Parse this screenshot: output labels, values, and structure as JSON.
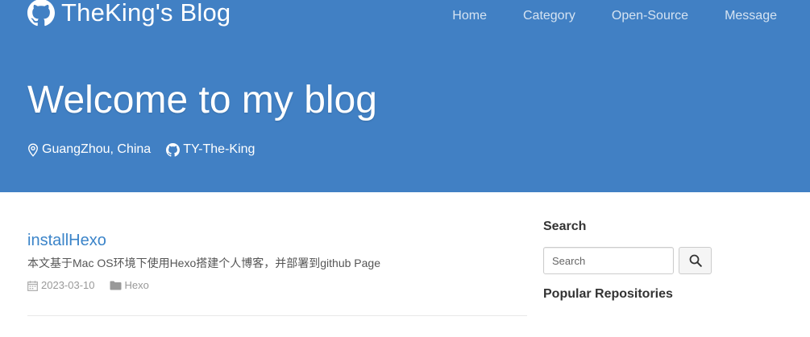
{
  "header": {
    "brand": {
      "title": "TheKing's Blog",
      "icon": "github-icon"
    },
    "nav": [
      {
        "label": "Home"
      },
      {
        "label": "Category"
      },
      {
        "label": "Open-Source"
      },
      {
        "label": "Message"
      }
    ],
    "hero_title": "Welcome to my blog",
    "location": {
      "icon": "location-pin-icon",
      "text": "GuangZhou, China"
    },
    "github_user": {
      "icon": "github-icon",
      "text": "TY-The-King"
    },
    "background_color": "#4180c4"
  },
  "posts": [
    {
      "title": "installHexo",
      "excerpt": "本文基于Mac OS环境下使用Hexo搭建个人博客，并部署到github Page",
      "date": "2023-03-10",
      "date_icon": "calendar-icon",
      "category": "Hexo",
      "category_icon": "folder-icon"
    }
  ],
  "sidebar": {
    "search": {
      "heading": "Search",
      "placeholder": "Search",
      "button_icon": "search-icon"
    },
    "popular_heading": "Popular Repositories"
  },
  "colors": {
    "accent": "#4180c4",
    "link": "#3b84c9"
  }
}
